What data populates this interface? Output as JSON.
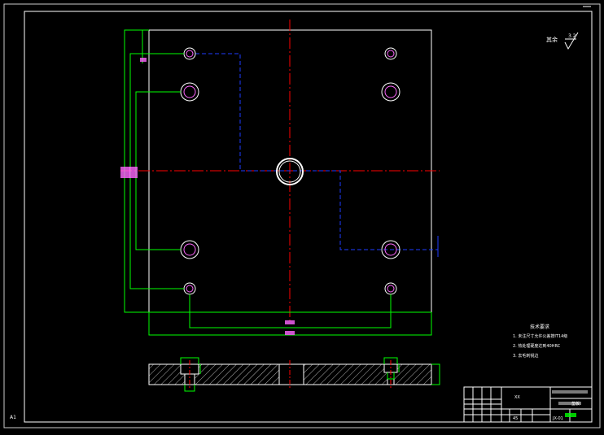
{
  "surface_finish": {
    "text": "其余",
    "value": "3.2"
  },
  "tech_notes": {
    "title": "技术要求",
    "items": [
      "1. 未注尺寸允许公差按IT14级",
      "2. 热处理硬度达到40HRC",
      "3. 去毛刺锐边"
    ]
  },
  "corner_label": "A1",
  "title_block": {
    "company": "XX",
    "name": "垫板",
    "material": "45",
    "drawing_no": "JX-01"
  },
  "colors": {
    "background": "#000000",
    "outline": "#ffffff",
    "dimension": "#00ff00",
    "centerline": "#ff0000",
    "hidden": "#1e3cff",
    "hole": "#ff66ff"
  }
}
